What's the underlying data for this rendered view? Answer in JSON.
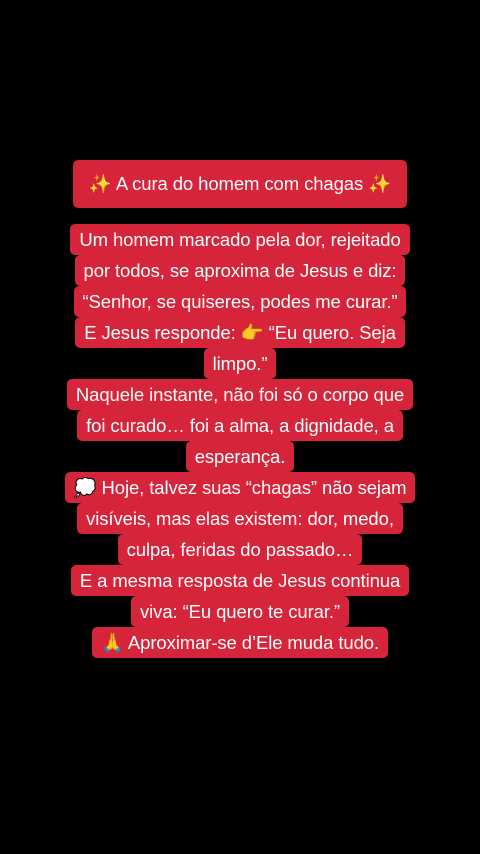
{
  "post": {
    "title": "✨ A cura do homem com chagas ✨",
    "lines": [
      "Um homem marcado pela dor, rejeitado",
      "por todos, se aproxima de Jesus e diz:",
      "“Senhor, se quiseres, podes me curar.”",
      "E Jesus responde: 👉 “Eu quero. Seja",
      "limpo.”",
      "Naquele instante, não foi só o corpo que",
      "foi curado… foi a alma, a dignidade, a",
      "esperança.",
      "💭 Hoje, talvez suas “chagas” não sejam",
      "visíveis, mas elas existem: dor, medo,",
      "culpa, feridas do passado…",
      "E a mesma resposta de Jesus continua",
      "viva: “Eu quero te curar.”",
      "🙏 Aproximar-se d’Ele muda tudo."
    ]
  },
  "colors": {
    "background": "#000000",
    "highlight": "#d6243a",
    "text": "#ffffff"
  }
}
